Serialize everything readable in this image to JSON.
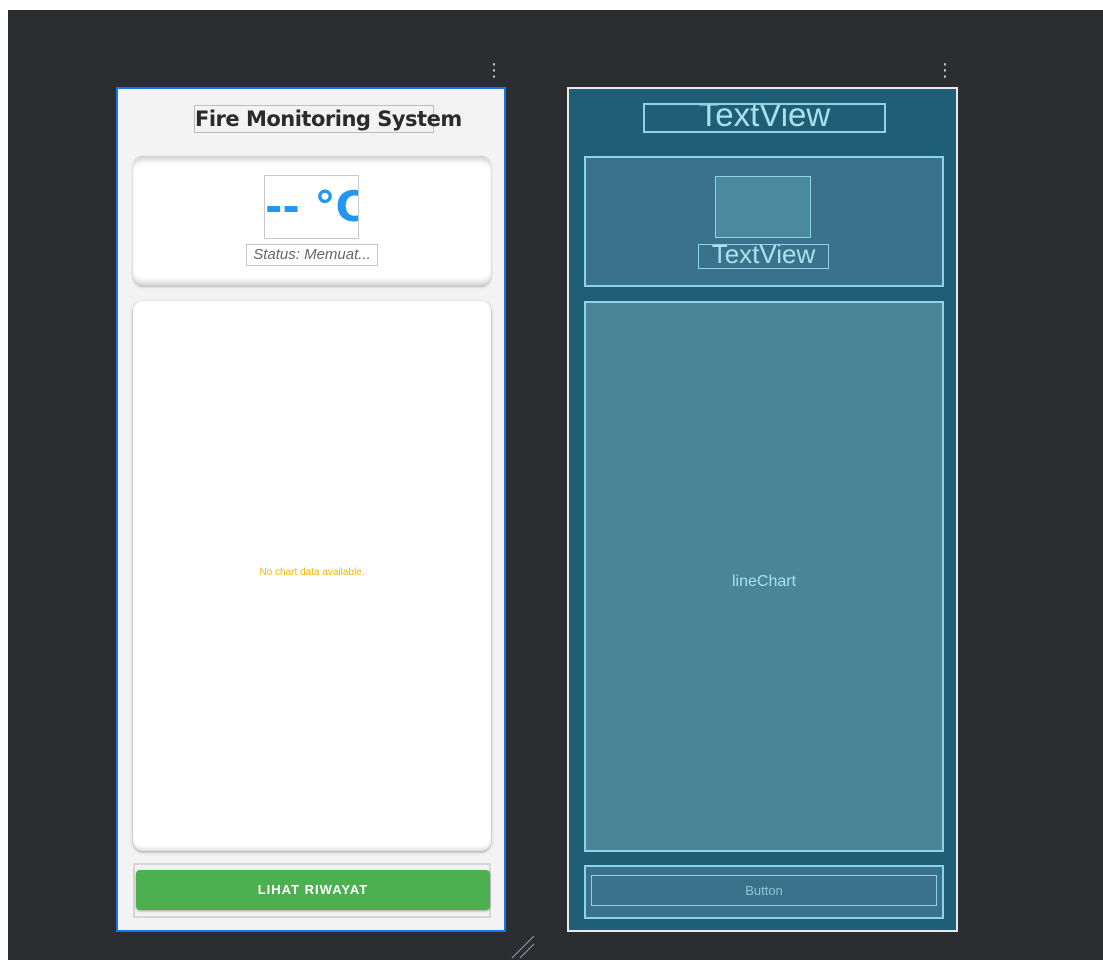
{
  "design_view": {
    "title": "Fire Monitoring System",
    "temperature": "-- °C",
    "status": "Status: Memuat...",
    "chart_empty_message": "No chart data available.",
    "history_button": "LIHAT RIWAYAT",
    "colors": {
      "accent_blue": "#2196f3",
      "button_green": "#4caf50",
      "empty_text": "#f5b400"
    }
  },
  "blueprint_view": {
    "title_label": "TextView",
    "image_label": "",
    "status_label": "TextView",
    "chart_label": "lineChart",
    "button_label": "Button"
  },
  "icons": {
    "overflow": "vertical-ellipsis-icon",
    "resize": "resize-handle-icon"
  }
}
